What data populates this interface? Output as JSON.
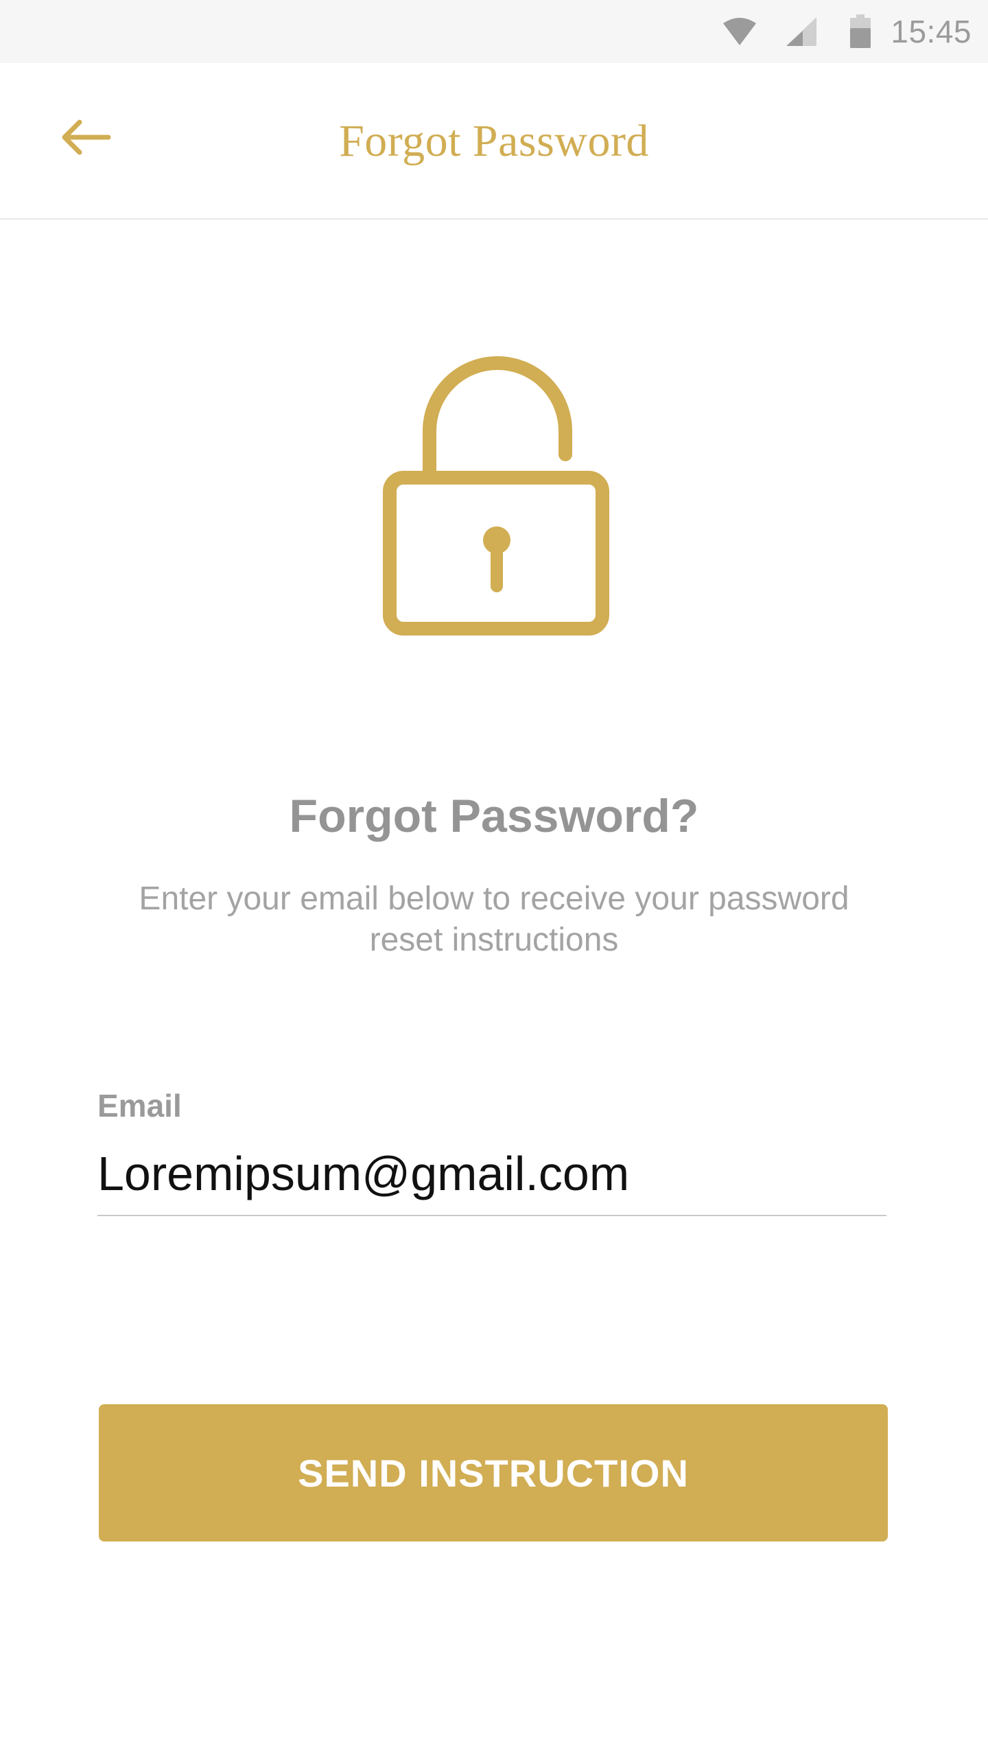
{
  "status_bar": {
    "time": "15:45",
    "icons": [
      "wifi-icon",
      "signal-icon",
      "battery-icon"
    ]
  },
  "app_bar": {
    "title": "Forgot Password",
    "back_icon": "back-arrow-icon"
  },
  "content": {
    "icon": "padlock-icon",
    "heading": "Forgot Password?",
    "subtext": "Enter your email below to receive your password reset instructions"
  },
  "form": {
    "email_label": "Email",
    "email_value": "Loremipsum@gmail.com"
  },
  "actions": {
    "send_label": "SEND INSTRUCTION"
  },
  "colors": {
    "accent": "#d1ad53",
    "heading": "#949494",
    "subtext": "#a3a3a3",
    "status_bar": "#f6f6f6"
  }
}
